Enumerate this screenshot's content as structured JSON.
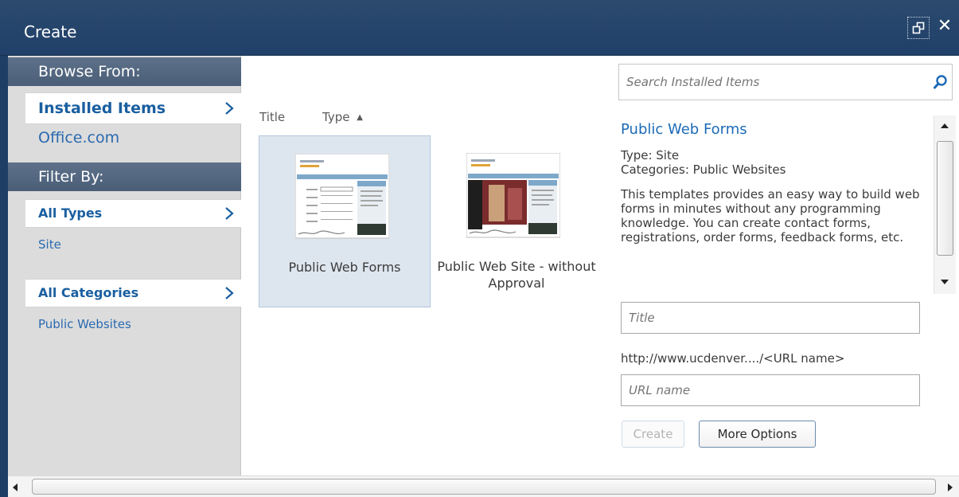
{
  "window": {
    "title": "Create",
    "restore_icon": "restore-window-icon",
    "close_icon": "close-icon",
    "close_glyph": "✕"
  },
  "sidebar": {
    "browse_header": "Browse From:",
    "browse_items": [
      {
        "label": "Installed Items",
        "selected": true
      },
      {
        "label": "Office.com",
        "selected": false
      }
    ],
    "filter_header": "Filter By:",
    "type_filter": {
      "label": "All Types",
      "options": [
        "Site"
      ]
    },
    "category_filter": {
      "label": "All Categories",
      "options": [
        "Public Websites"
      ]
    }
  },
  "list": {
    "columns": [
      "Title",
      "Type"
    ],
    "sort_indicator": "▲",
    "sort_column": "Type",
    "items": [
      {
        "title": "Public Web Forms",
        "selected": true
      },
      {
        "title": "Public Web Site - without Approval",
        "selected": false
      }
    ]
  },
  "search": {
    "placeholder": "Search Installed Items",
    "icon": "search-icon"
  },
  "details": {
    "name": "Public Web Forms",
    "type_line": "Type: Site",
    "categories_line": "Categories: Public Websites",
    "description": "This templates provides an easy way to build web forms in minutes without any programming knowledge. You can create contact forms, registrations, order forms, feedback forms, etc."
  },
  "form": {
    "title_placeholder": "Title",
    "url_prefix": "http://www.ucdenver..../<URL name>",
    "url_placeholder": "URL name",
    "create_label": "Create",
    "more_options_label": "More Options"
  },
  "colors": {
    "titlebar": "#21406a",
    "accent_link": "#1c6ab6",
    "sidebar_bg": "#dcdcdc",
    "section_header": "#4a5e78"
  }
}
